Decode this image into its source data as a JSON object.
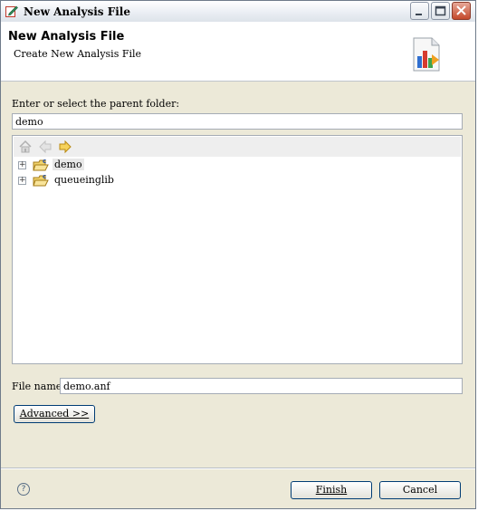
{
  "window": {
    "title": "New Analysis File",
    "icons": {
      "app": "edit-pencil-icon",
      "minimize": "minimize-icon",
      "maximize": "maximize-icon",
      "close": "close-icon"
    }
  },
  "banner": {
    "title": "New Analysis File",
    "subtitle": "Create New Analysis File",
    "image": "bar-chart-document-icon"
  },
  "parent_folder": {
    "label": "Enter or select the parent folder:",
    "value": "demo"
  },
  "tree": {
    "toolbar": {
      "home": "home-icon",
      "back": "back-arrow-icon",
      "forward": "forward-arrow-icon"
    },
    "items": [
      {
        "label": "demo",
        "selected": true,
        "icon": "c-project-folder-icon"
      },
      {
        "label": "queueinglib",
        "selected": false,
        "icon": "c-project-folder-icon"
      }
    ]
  },
  "file_name": {
    "label": "File name:",
    "value": "demo.anf"
  },
  "buttons": {
    "advanced": "Advanced >>",
    "finish": "Finish",
    "cancel": "Cancel",
    "help": "?"
  },
  "colors": {
    "accent_border": "#003c74",
    "dialog_bg": "#ece9d8",
    "close_red": "#c4492b"
  }
}
